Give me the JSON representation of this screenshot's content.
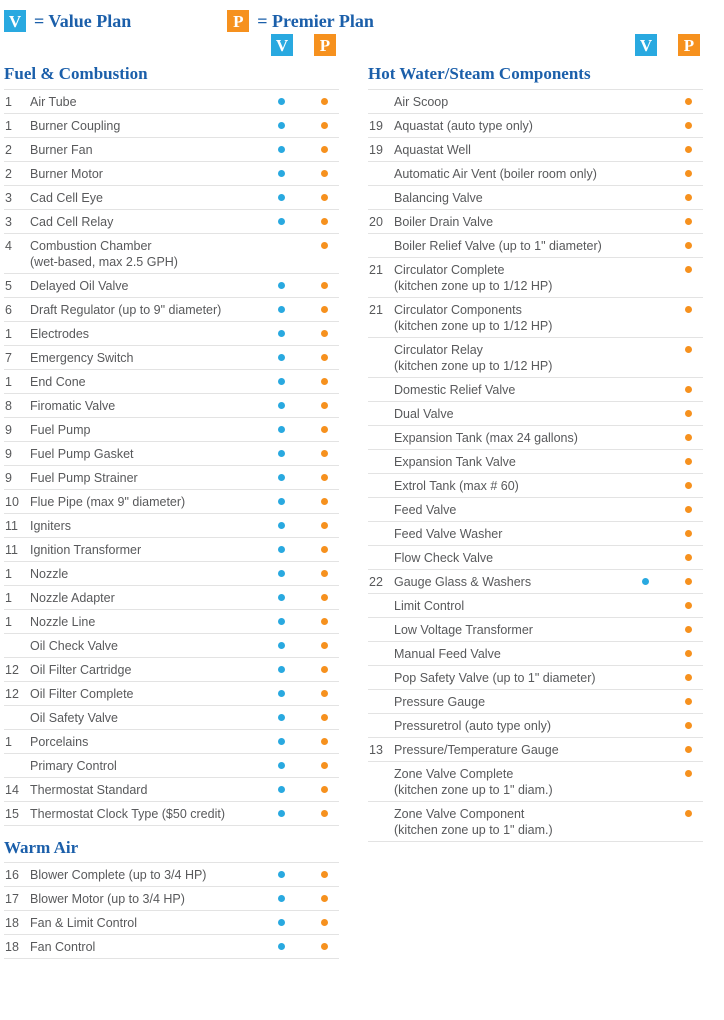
{
  "legend": {
    "value": {
      "badge": "V",
      "text": "= Value Plan",
      "icon": "value-plan-badge-icon",
      "color": "#29a9e0"
    },
    "premier": {
      "badge": "P",
      "text": "= Premier Plan",
      "icon": "premier-plan-badge-icon",
      "color": "#f6911e"
    }
  },
  "column_headers": {
    "value": "V",
    "premier": "P"
  },
  "columns": [
    {
      "id": "left",
      "sections": [
        {
          "title": "Fuel & Combustion",
          "rows": [
            {
              "num": "1",
              "label": "Air Tube",
              "sub": "",
              "value": true,
              "premier": true
            },
            {
              "num": "1",
              "label": "Burner Coupling",
              "sub": "",
              "value": true,
              "premier": true
            },
            {
              "num": "2",
              "label": "Burner Fan",
              "sub": "",
              "value": true,
              "premier": true
            },
            {
              "num": "2",
              "label": "Burner Motor",
              "sub": "",
              "value": true,
              "premier": true
            },
            {
              "num": "3",
              "label": "Cad Cell Eye",
              "sub": "",
              "value": true,
              "premier": true
            },
            {
              "num": "3",
              "label": "Cad Cell Relay",
              "sub": "",
              "value": true,
              "premier": true
            },
            {
              "num": "4",
              "label": "Combustion Chamber",
              "sub": "(wet-based, max 2.5 GPH)",
              "value": false,
              "premier": true
            },
            {
              "num": "5",
              "label": "Delayed Oil Valve",
              "sub": "",
              "value": true,
              "premier": true
            },
            {
              "num": "6",
              "label": "Draft Regulator (up to 9\" diameter)",
              "sub": "",
              "value": true,
              "premier": true
            },
            {
              "num": "1",
              "label": "Electrodes",
              "sub": "",
              "value": true,
              "premier": true
            },
            {
              "num": "7",
              "label": "Emergency Switch",
              "sub": "",
              "value": true,
              "premier": true
            },
            {
              "num": "1",
              "label": "End Cone",
              "sub": "",
              "value": true,
              "premier": true
            },
            {
              "num": "8",
              "label": "Firomatic Valve",
              "sub": "",
              "value": true,
              "premier": true
            },
            {
              "num": "9",
              "label": "Fuel Pump",
              "sub": "",
              "value": true,
              "premier": true
            },
            {
              "num": "9",
              "label": "Fuel Pump Gasket",
              "sub": "",
              "value": true,
              "premier": true
            },
            {
              "num": "9",
              "label": "Fuel Pump Strainer",
              "sub": "",
              "value": true,
              "premier": true
            },
            {
              "num": "10",
              "label": "Flue Pipe (max 9\" diameter)",
              "sub": "",
              "value": true,
              "premier": true
            },
            {
              "num": "11",
              "label": "Igniters",
              "sub": "",
              "value": true,
              "premier": true
            },
            {
              "num": "11",
              "label": "Ignition Transformer",
              "sub": "",
              "value": true,
              "premier": true
            },
            {
              "num": "1",
              "label": "Nozzle",
              "sub": "",
              "value": true,
              "premier": true
            },
            {
              "num": "1",
              "label": "Nozzle Adapter",
              "sub": "",
              "value": true,
              "premier": true
            },
            {
              "num": "1",
              "label": "Nozzle Line",
              "sub": "",
              "value": true,
              "premier": true
            },
            {
              "num": "",
              "label": "Oil Check Valve",
              "sub": "",
              "value": true,
              "premier": true
            },
            {
              "num": "12",
              "label": "Oil Filter Cartridge",
              "sub": "",
              "value": true,
              "premier": true
            },
            {
              "num": "12",
              "label": "Oil Filter Complete",
              "sub": "",
              "value": true,
              "premier": true
            },
            {
              "num": "",
              "label": "Oil Safety Valve",
              "sub": "",
              "value": true,
              "premier": true
            },
            {
              "num": "1",
              "label": "Porcelains",
              "sub": "",
              "value": true,
              "premier": true
            },
            {
              "num": "",
              "label": "Primary Control",
              "sub": "",
              "value": true,
              "premier": true
            },
            {
              "num": "14",
              "label": "Thermostat Standard",
              "sub": "",
              "value": true,
              "premier": true
            },
            {
              "num": "15",
              "label": "Thermostat Clock Type ($50 credit)",
              "sub": "",
              "value": true,
              "premier": true
            }
          ]
        },
        {
          "title": "Warm Air",
          "rows": [
            {
              "num": "16",
              "label": "Blower Complete (up to 3/4 HP)",
              "sub": "",
              "value": true,
              "premier": true
            },
            {
              "num": "17",
              "label": "Blower Motor (up to 3/4 HP)",
              "sub": "",
              "value": true,
              "premier": true
            },
            {
              "num": "18",
              "label": "Fan & Limit Control",
              "sub": "",
              "value": true,
              "premier": true
            },
            {
              "num": "18",
              "label": "Fan Control",
              "sub": "",
              "value": true,
              "premier": true
            }
          ]
        }
      ]
    },
    {
      "id": "right",
      "sections": [
        {
          "title": "Hot Water/Steam Components",
          "rows": [
            {
              "num": "",
              "label": "Air Scoop",
              "sub": "",
              "value": false,
              "premier": true
            },
            {
              "num": "19",
              "label": "Aquastat (auto type only)",
              "sub": "",
              "value": false,
              "premier": true
            },
            {
              "num": "19",
              "label": "Aquastat Well",
              "sub": "",
              "value": false,
              "premier": true
            },
            {
              "num": "",
              "label": "Automatic Air Vent (boiler room only)",
              "sub": "",
              "value": false,
              "premier": true
            },
            {
              "num": "",
              "label": "Balancing Valve",
              "sub": "",
              "value": false,
              "premier": true
            },
            {
              "num": "20",
              "label": "Boiler Drain Valve",
              "sub": "",
              "value": false,
              "premier": true
            },
            {
              "num": "",
              "label": "Boiler Relief Valve (up to 1\" diameter)",
              "sub": "",
              "value": false,
              "premier": true
            },
            {
              "num": "21",
              "label": "Circulator Complete",
              "sub": "(kitchen zone up to 1/12 HP)",
              "value": false,
              "premier": true
            },
            {
              "num": "21",
              "label": "Circulator Components",
              "sub": "(kitchen zone up to 1/12 HP)",
              "value": false,
              "premier": true
            },
            {
              "num": "",
              "label": "Circulator Relay",
              "sub": "(kitchen zone up to 1/12 HP)",
              "value": false,
              "premier": true
            },
            {
              "num": "",
              "label": "Domestic Relief Valve",
              "sub": "",
              "value": false,
              "premier": true
            },
            {
              "num": "",
              "label": "Dual Valve",
              "sub": "",
              "value": false,
              "premier": true
            },
            {
              "num": "",
              "label": "Expansion Tank (max 24 gallons)",
              "sub": "",
              "value": false,
              "premier": true
            },
            {
              "num": "",
              "label": "Expansion Tank Valve",
              "sub": "",
              "value": false,
              "premier": true
            },
            {
              "num": "",
              "label": "Extrol Tank (max # 60)",
              "sub": "",
              "value": false,
              "premier": true
            },
            {
              "num": "",
              "label": "Feed Valve",
              "sub": "",
              "value": false,
              "premier": true
            },
            {
              "num": "",
              "label": "Feed Valve Washer",
              "sub": "",
              "value": false,
              "premier": true
            },
            {
              "num": "",
              "label": "Flow Check Valve",
              "sub": "",
              "value": false,
              "premier": true
            },
            {
              "num": "22",
              "label": "Gauge Glass & Washers",
              "sub": "",
              "value": true,
              "premier": true
            },
            {
              "num": "",
              "label": "Limit Control",
              "sub": "",
              "value": false,
              "premier": true
            },
            {
              "num": "",
              "label": "Low Voltage Transformer",
              "sub": "",
              "value": false,
              "premier": true
            },
            {
              "num": "",
              "label": "Manual Feed Valve",
              "sub": "",
              "value": false,
              "premier": true
            },
            {
              "num": "",
              "label": "Pop Safety Valve (up to 1\" diameter)",
              "sub": "",
              "value": false,
              "premier": true
            },
            {
              "num": "",
              "label": "Pressure Gauge",
              "sub": "",
              "value": false,
              "premier": true
            },
            {
              "num": "",
              "label": "Pressuretrol (auto type only)",
              "sub": "",
              "value": false,
              "premier": true
            },
            {
              "num": "13",
              "label": "Pressure/Temperature Gauge",
              "sub": "",
              "value": false,
              "premier": true
            },
            {
              "num": "",
              "label": "Zone Valve Complete",
              "sub": "(kitchen zone up to 1\" diam.)",
              "value": false,
              "premier": true
            },
            {
              "num": "",
              "label": "Zone Valve Component",
              "sub": "(kitchen zone up to 1\" diam.)",
              "value": false,
              "premier": true
            }
          ]
        }
      ]
    }
  ]
}
